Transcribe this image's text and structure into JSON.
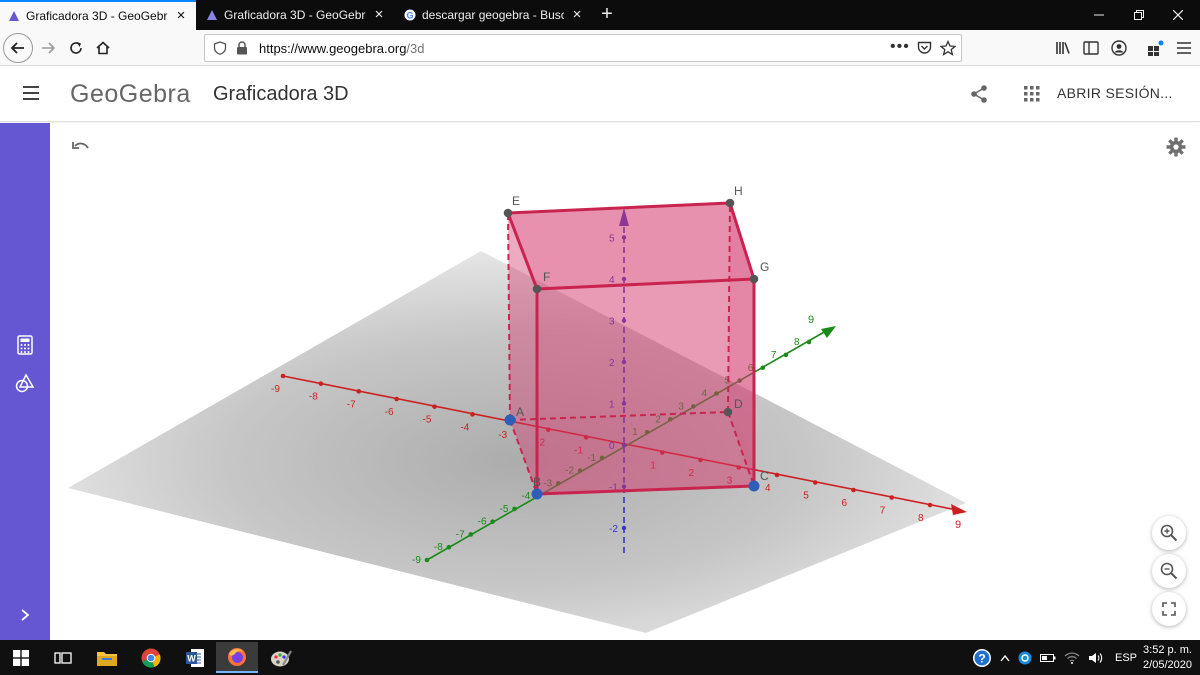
{
  "browser": {
    "tabs": [
      {
        "title": "Graficadora 3D - GeoGebra",
        "active": true
      },
      {
        "title": "Graficadora 3D - GeoGebra",
        "active": false
      },
      {
        "title": "descargar geogebra - Buscar co",
        "active": false
      }
    ],
    "url_host": "https://www.geogebra.org",
    "url_path": "/3d"
  },
  "header": {
    "logo": "GeoGebra",
    "app_title": "Graficadora 3D",
    "sign_in": "ABRIR SESIÓN..."
  },
  "scene": {
    "points": {
      "E": "E",
      "H": "H",
      "F": "F",
      "G": "G",
      "A": "A",
      "B": "B",
      "C": "C",
      "D": "D"
    },
    "x_axis": {
      "end_label": "9",
      "ticks": [
        "-9",
        "-8",
        "-7",
        "-6",
        "-5",
        "-4",
        "-3",
        "-2",
        "-1",
        "1",
        "2",
        "3",
        "4",
        "5",
        "6",
        "7",
        "8"
      ]
    },
    "y_axis": {
      "end_label": "9",
      "ticks": [
        "-9",
        "-8",
        "-7",
        "-6",
        "-5",
        "-4",
        "-3",
        "-2",
        "-1",
        "1",
        "2",
        "3",
        "4",
        "5",
        "6",
        "7",
        "8"
      ]
    },
    "z_axis": {
      "ticks": [
        "5",
        "4",
        "3",
        "2",
        "1",
        "0",
        "-1",
        "-2"
      ]
    },
    "colors": {
      "prism_fill": "#d4376d",
      "prism_edge": "#c8244f",
      "x_axis": "#cc1f1f",
      "y_axis": "#1b8a1b",
      "z_axis": "#3535c8",
      "point_blue": "#2e5fb8",
      "point_gray": "#555555"
    }
  },
  "taskbar": {
    "lang": "ESP",
    "time": "3:52 p. m.",
    "date": "2/05/2020"
  }
}
